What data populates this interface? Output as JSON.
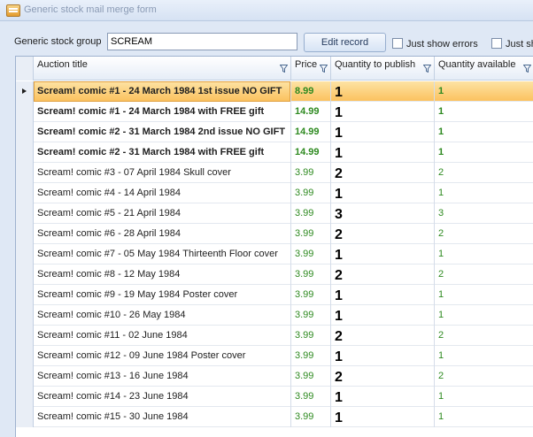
{
  "window": {
    "title": "Generic stock mail merge form",
    "icon": "mail-merge-form-icon"
  },
  "toolbar": {
    "group_label": "Generic stock group",
    "group_value": "SCREAM",
    "edit_label": "Edit record",
    "errors_label": "Just show errors",
    "second_label": "Just sh"
  },
  "grid": {
    "columns": [
      "Auction title",
      "Price",
      "Quantity to publish",
      "Quantity available"
    ],
    "rows": [
      {
        "title": "Scream! comic #1 - 24 March 1984 1st issue NO GIFT",
        "price": "8.99",
        "qty": "1",
        "avail": "1"
      },
      {
        "title": "Scream! comic #1 - 24 March 1984 with FREE gift",
        "price": "14.99",
        "qty": "1",
        "avail": "1"
      },
      {
        "title": "Scream! comic #2 - 31 March 1984 2nd issue NO GIFT",
        "price": "14.99",
        "qty": "1",
        "avail": "1"
      },
      {
        "title": "Scream! comic #2 - 31 March 1984 with FREE gift",
        "price": "14.99",
        "qty": "1",
        "avail": "1"
      },
      {
        "title": "Scream! comic #3 - 07 April 1984 Skull cover",
        "price": "3.99",
        "qty": "2",
        "avail": "2"
      },
      {
        "title": "Scream! comic #4 - 14 April 1984",
        "price": "3.99",
        "qty": "1",
        "avail": "1"
      },
      {
        "title": "Scream! comic #5 - 21 April 1984",
        "price": "3.99",
        "qty": "3",
        "avail": "3"
      },
      {
        "title": "Scream! comic #6 - 28 April 1984",
        "price": "3.99",
        "qty": "2",
        "avail": "2"
      },
      {
        "title": "Scream! comic #7 - 05 May 1984 Thirteenth Floor cover",
        "price": "3.99",
        "qty": "1",
        "avail": "1"
      },
      {
        "title": "Scream! comic #8 - 12 May 1984",
        "price": "3.99",
        "qty": "2",
        "avail": "2"
      },
      {
        "title": "Scream! comic #9 - 19 May 1984 Poster cover",
        "price": "3.99",
        "qty": "1",
        "avail": "1"
      },
      {
        "title": "Scream! comic #10 - 26 May 1984",
        "price": "3.99",
        "qty": "1",
        "avail": "1"
      },
      {
        "title": "Scream! comic #11 - 02 June 1984",
        "price": "3.99",
        "qty": "2",
        "avail": "2"
      },
      {
        "title": "Scream! comic #12 - 09 June 1984 Poster cover",
        "price": "3.99",
        "qty": "1",
        "avail": "1"
      },
      {
        "title": "Scream! comic #13 - 16 June 1984",
        "price": "3.99",
        "qty": "2",
        "avail": "2"
      },
      {
        "title": "Scream! comic #14 - 23 June 1984",
        "price": "3.99",
        "qty": "1",
        "avail": "1"
      },
      {
        "title": "Scream! comic #15 - 30 June 1984",
        "price": "3.99",
        "qty": "1",
        "avail": "1"
      }
    ]
  },
  "colors": {
    "price_green": "#2e8a20",
    "selected_row": "#fbc25f"
  }
}
